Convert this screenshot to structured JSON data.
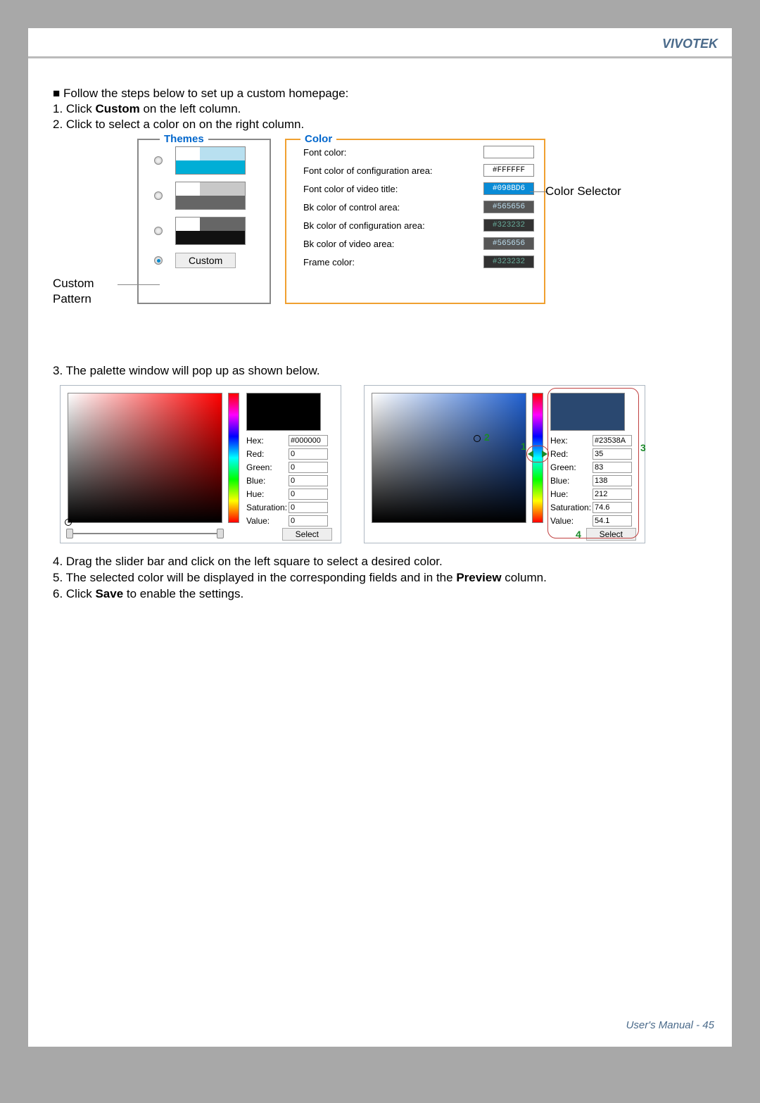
{
  "brand": "VIVOTEK",
  "intro": {
    "l1": "■ Follow the steps below to set up a custom homepage:",
    "l2_a": "1. Click ",
    "l2_b": "Custom",
    "l2_c": " on the left column.",
    "l3": "2. Click to select a color on on the right column."
  },
  "labels": {
    "custom_pattern": "Custom\nPattern",
    "color_selector": "Color Selector",
    "themes": "Themes",
    "color": "Color",
    "custom_btn": "Custom"
  },
  "color_rows": {
    "r1": {
      "label": "Font color:",
      "val": "",
      "bg": "#ffffff",
      "fg": "#000"
    },
    "r2": {
      "label": "Font color of configuration area:",
      "val": "#FFFFFF",
      "bg": "#ffffff",
      "fg": "#000"
    },
    "r3": {
      "label": "Font color of video title:",
      "val": "#098BD6",
      "bg": "#098BD6",
      "fg": "#fff"
    },
    "r4": {
      "label": "Bk color of control area:",
      "val": "#565656",
      "bg": "#565656",
      "fg": "#dff"
    },
    "r5": {
      "label": "Bk color of configuration area:",
      "val": "#323232",
      "bg": "#323232",
      "fg": "#6aa"
    },
    "r6": {
      "label": "Bk color of video area:",
      "val": "#565656",
      "bg": "#565656",
      "fg": "#dff"
    },
    "r7": {
      "label": "Frame color:",
      "val": "#323232",
      "bg": "#323232",
      "fg": "#6aa"
    }
  },
  "step3": "3. The palette window will pop up as shown below.",
  "palette_fields": {
    "hex": "Hex:",
    "red": "Red:",
    "green": "Green:",
    "blue": "Blue:",
    "hue": "Hue:",
    "sat": "Saturation:",
    "val": "Value:",
    "select": "Select"
  },
  "palette_a": {
    "hex": "#000000",
    "red": "0",
    "green": "0",
    "blue": "0",
    "hue": "0",
    "sat": "0",
    "val": "0"
  },
  "palette_b": {
    "hex": "#23538A",
    "red": "35",
    "green": "83",
    "blue": "138",
    "hue": "212",
    "sat": "74.6",
    "val": "54.1"
  },
  "callouts": {
    "n1": "1",
    "n2": "2",
    "n3": "3",
    "n4": "4"
  },
  "steps456": {
    "s4": "4. Drag the slider bar and click on the left square to select a desired color.",
    "s5_a": "5. The selected color will be displayed in the corresponding fields and in the ",
    "s5_b": "Preview",
    "s5_c": " column.",
    "s6_a": "6. Click ",
    "s6_b": "Save",
    "s6_c": " to enable the settings."
  },
  "footer": "User's Manual - 45"
}
